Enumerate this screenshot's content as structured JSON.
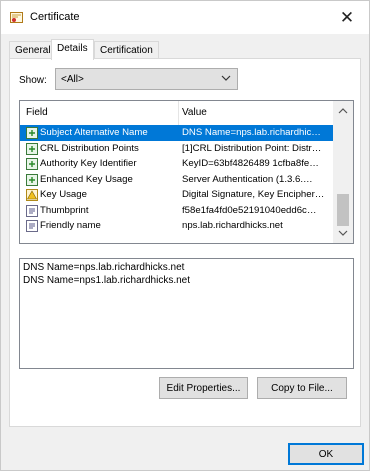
{
  "window": {
    "title": "Certificate",
    "close_glyph": "✕"
  },
  "tabs": [
    {
      "label": "General"
    },
    {
      "label": "Details"
    },
    {
      "label": "Certification Path"
    }
  ],
  "show": {
    "label": "Show:",
    "value": "<All>"
  },
  "list": {
    "columns": {
      "field": "Field",
      "value": "Value"
    },
    "rows": [
      {
        "field": "Subject Alternative Name",
        "value": "DNS Name=nps.lab.richardhic…",
        "icon": "extension-icon",
        "selected": true
      },
      {
        "field": "CRL Distribution Points",
        "value": "[1]CRL Distribution Point: Distr…",
        "icon": "extension-icon"
      },
      {
        "field": "Authority Key Identifier",
        "value": "KeyID=63bf4826489 1cfba8fe…",
        "icon": "extension-icon"
      },
      {
        "field": "Enhanced Key Usage",
        "value": "Server Authentication (1.3.6.…",
        "icon": "extension-icon"
      },
      {
        "field": "Key Usage",
        "value": "Digital Signature, Key Encipher…",
        "icon": "warning-extension-icon"
      },
      {
        "field": "Thumbprint",
        "value": "f58e1fa4fd0e52191040edd6c…",
        "icon": "property-icon"
      },
      {
        "field": "Friendly name",
        "value": "nps.lab.richardhicks.net",
        "icon": "property-icon"
      }
    ]
  },
  "detail": {
    "lines": [
      "DNS Name=nps.lab.richardhicks.net",
      "DNS Name=nps1.lab.richardhicks.net"
    ]
  },
  "buttons": {
    "edit_properties": "Edit Properties...",
    "copy_to_file": "Copy to File...",
    "ok": "OK"
  },
  "colors": {
    "selection": "#0078d7",
    "ok_border": "#0078d7"
  }
}
